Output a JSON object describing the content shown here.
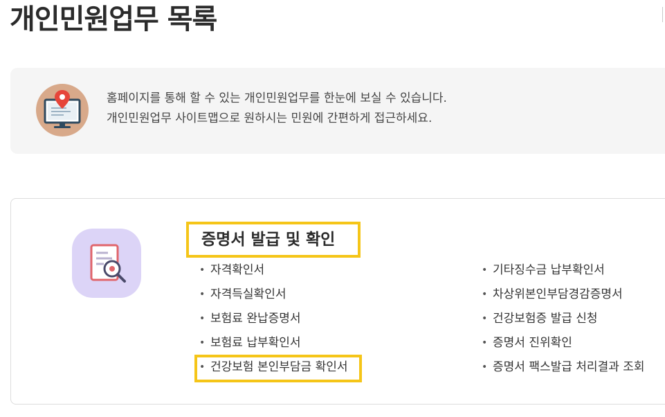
{
  "page": {
    "title": "개인민원업무 목록"
  },
  "info": {
    "line1": "홈페이지를 통해 할 수 있는 개인민원업무를 한눈에 보실 수 있습니다.",
    "line2": "개인민원업무 사이트맵으로 원하시는 민원에 간편하게 접근하세요.",
    "icon": "monitor-location-pin-icon"
  },
  "section": {
    "title": "증명서 발급 및 확인",
    "icon": "document-magnifier-icon",
    "bullet": "•",
    "left_items": [
      "자격확인서",
      "자격득실확인서",
      "보험료 완납증명서",
      "보험료 납부확인서",
      "건강보험 본인부담금 확인서"
    ],
    "right_items": [
      "기타징수금 납부확인서",
      "차상위본인부담경감증명서",
      "건강보험증 발급 신청",
      "증명서 진위확인",
      "증명서 팩스발급 처리결과 조회"
    ]
  },
  "colors": {
    "highlight": "#f5c518",
    "info_bg": "#f5f5f5",
    "info_icon_bg": "#d8a98a",
    "card_icon_bg": "#dcd4f7"
  }
}
